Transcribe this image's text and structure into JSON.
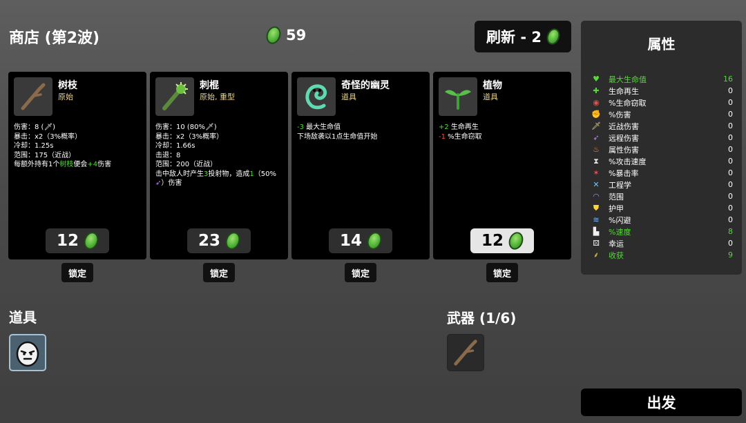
{
  "header": {
    "shop_title": "商店 (第2波)",
    "gold": "59",
    "reroll_label": "刷新 - 2"
  },
  "cards": [
    {
      "name": "树枝",
      "tags": "原始",
      "price": "12",
      "lock": "锁定",
      "icon": "stick-icon"
    },
    {
      "name": "刺棍",
      "tags": "原始, 重型",
      "price": "23",
      "lock": "锁定",
      "icon": "spiked-club-icon"
    },
    {
      "name": "奇怪的幽灵",
      "tags": "道具",
      "price": "14",
      "lock": "锁定",
      "icon": "ghost-icon"
    },
    {
      "name": "植物",
      "tags": "道具",
      "price": "12",
      "lock": "锁定",
      "icon": "plant-icon",
      "highlighted": true
    }
  ],
  "card_text": {
    "stick": {
      "l1": "伤害：8 (",
      "l1b": ")",
      "l2": "暴击：x2（3%概率）",
      "l3": "冷却：1.25s",
      "l4": "范围：175（近战）",
      "l5a": "每额外持有1个",
      "l5b": "树枝",
      "l5c": "便会",
      "l5d": "+4",
      "l5e": "伤害"
    },
    "club": {
      "l1": "伤害：10 (80%",
      "l1b": ")",
      "l2": "暴击：x2（3%概率）",
      "l3": "冷却：1.66s",
      "l4": "击退：8",
      "l5": "范围：200（近战）",
      "l6a": "击中敌人时产生",
      "l6b": "3",
      "l6c": "投射物，造成",
      "l6d": "1",
      "l6e": "（50%",
      "l7": "）伤害"
    },
    "ghost": {
      "l1a": "-3",
      "l1b": " 最大生命值",
      "l2": "下场敌袭以1点生命值开始"
    },
    "plant": {
      "l1a": "+2",
      "l1b": " 生命再生",
      "l2a": "-1",
      "l2b": " %生命窃取"
    }
  },
  "items_section": {
    "title": "道具",
    "slots": [
      "potato-face-icon"
    ]
  },
  "weapons_section": {
    "title": "武器 (1/6)",
    "slots": [
      "stick-icon"
    ]
  },
  "stats": {
    "title": "属性",
    "rows": [
      {
        "label": "最大生命值",
        "value": "16",
        "icon": "heart-icon",
        "color": "#56d73a"
      },
      {
        "label": "生命再生",
        "value": "0",
        "icon": "heart-plus-icon",
        "color": "#ffffff"
      },
      {
        "label": "%生命窃取",
        "value": "0",
        "icon": "fangs-icon",
        "color": "#ffffff"
      },
      {
        "label": "%伤害",
        "value": "0",
        "icon": "muscle-icon",
        "color": "#ffffff"
      },
      {
        "label": "近战伤害",
        "value": "0",
        "icon": "sword-icon",
        "color": "#ffffff"
      },
      {
        "label": "远程伤害",
        "value": "0",
        "icon": "bow-icon",
        "color": "#ffffff"
      },
      {
        "label": "属性伤害",
        "value": "0",
        "icon": "flame-icon",
        "color": "#ffffff"
      },
      {
        "label": "%攻击速度",
        "value": "0",
        "icon": "hourglass-icon",
        "color": "#ffffff"
      },
      {
        "label": "%暴击率",
        "value": "0",
        "icon": "crit-icon",
        "color": "#ffffff"
      },
      {
        "label": "工程学",
        "value": "0",
        "icon": "wrench-icon",
        "color": "#ffffff"
      },
      {
        "label": "范围",
        "value": "0",
        "icon": "range-icon",
        "color": "#ffffff"
      },
      {
        "label": "护甲",
        "value": "0",
        "icon": "shield-icon",
        "color": "#ffffff"
      },
      {
        "label": "%闪避",
        "value": "0",
        "icon": "dodge-icon",
        "color": "#ffffff"
      },
      {
        "label": "%速度",
        "value": "8",
        "icon": "boot-icon",
        "color": "#56d73a"
      },
      {
        "label": "幸运",
        "value": "0",
        "icon": "dice-icon",
        "color": "#ffffff"
      },
      {
        "label": "收获",
        "value": "9",
        "icon": "wheat-icon",
        "color": "#56d73a"
      }
    ]
  },
  "go_label": "出发",
  "colors": {
    "accent_green": "#56d73a",
    "negative_red": "#ff4a4a",
    "tag_yellow": "#e9d48f"
  }
}
